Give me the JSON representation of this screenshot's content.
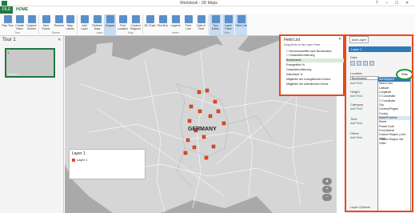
{
  "window": {
    "title": "Workbook - 3D Maps",
    "controls": [
      "?",
      "–",
      "☐",
      "✕"
    ]
  },
  "tabs": {
    "file": "FILE",
    "home": "HOME"
  },
  "ribbon": {
    "buttons": [
      {
        "label": "Play Tour",
        "icon": "play-icon"
      },
      {
        "label": "Create Video",
        "icon": "video-icon"
      },
      {
        "label": "Capture Screen",
        "icon": "camera-icon"
      },
      {
        "label": "New Scene",
        "icon": "new-scene-icon"
      },
      {
        "label": "Themes",
        "icon": "themes-icon"
      },
      {
        "label": "Map Labels",
        "icon": "map-labels-icon"
      },
      {
        "label": "Add Layer",
        "icon": "add-layer-icon"
      },
      {
        "label": "Refresh Data",
        "icon": "refresh-icon"
      },
      {
        "label": "Shapes",
        "icon": "shapes-icon"
      },
      {
        "label": "Find Location",
        "icon": "find-location-icon"
      },
      {
        "label": "Custom Regions",
        "icon": "custom-regions-icon"
      },
      {
        "label": "2D Chart",
        "icon": "chart-icon"
      },
      {
        "label": "Text Box",
        "icon": "textbox-icon"
      },
      {
        "label": "Legend",
        "icon": "legend-icon"
      },
      {
        "label": "Time Line",
        "icon": "timeline-icon"
      },
      {
        "label": "Date & Time",
        "icon": "datetime-icon"
      },
      {
        "label": "Tour Editor",
        "icon": "tour-editor-icon"
      },
      {
        "label": "Layer Pane",
        "icon": "layer-pane-icon"
      },
      {
        "label": "Field List",
        "icon": "field-list-icon"
      }
    ],
    "groups": [
      "Tour",
      "Scene",
      "Layer",
      "Map",
      "Insert",
      "View"
    ]
  },
  "tour_pane": {
    "title": "Tour 1",
    "scene_number": "1",
    "scene_label": "Scene 1"
  },
  "map": {
    "country_label": "GERMANY",
    "legend": {
      "title": "Layer 1",
      "entry": "Layer 1"
    },
    "nav": [
      "▲",
      "+",
      "–"
    ]
  },
  "field_list": {
    "title": "Field List",
    "subtitle": "Drag fields to the Layer Pane",
    "items": [
      {
        "label": "☐ Kirchenaustritte nach Bundesland",
        "selected": false
      },
      {
        "label": "  ☐ Gesamtbevölkerung",
        "selected": false
      },
      {
        "label": "  Bundesland",
        "selected": true
      },
      {
        "label": "  Evangelisch %",
        "selected": false
      },
      {
        "label": "  Gesamtbevölkerung",
        "selected": false
      },
      {
        "label": "  Katholisch %",
        "selected": false
      },
      {
        "label": "  Mitglieder der evangelischen Kirche",
        "selected": false
      },
      {
        "label": "  Mitglieder der katholischen Kirche",
        "selected": false
      }
    ]
  },
  "layer_pane": {
    "add_layer": "Add Layer",
    "layer_name": "Layer 1",
    "sections": {
      "data": "Data",
      "location": "Location",
      "height": "Height",
      "category": "Category",
      "time": "Time",
      "filters": "Filters",
      "layer_options": "Layer Options"
    },
    "location_field": "Bundesland",
    "add_field": "Add Field",
    "dropdown_selected": "State/Province",
    "circled_label": "State",
    "dropdown": [
      "Not Mapped",
      "Select One",
      "Latitude",
      "Longitude",
      "X Coordinate",
      "Y Coordinate",
      "City",
      "Country/Region",
      "County",
      "State/Province",
      "Street",
      "Postal Code",
      "Full Address",
      "Custom Region (.kml, .shp)",
      "Custom Region Set",
      "Other"
    ],
    "dropdown_highlight_index": 0
  }
}
